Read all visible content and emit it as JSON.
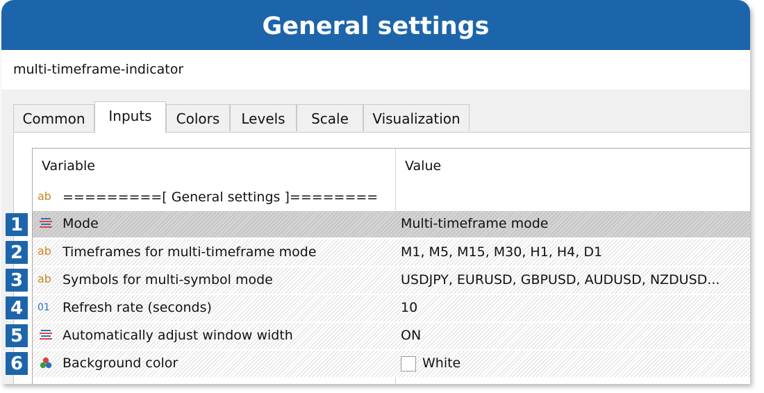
{
  "banner": {
    "title": "General settings"
  },
  "window": {
    "title": "multi-timeframe-indicator"
  },
  "tabs": [
    {
      "label": "Common",
      "active": false
    },
    {
      "label": "Inputs",
      "active": true
    },
    {
      "label": "Colors",
      "active": false
    },
    {
      "label": "Levels",
      "active": false
    },
    {
      "label": "Scale",
      "active": false
    },
    {
      "label": "Visualization",
      "active": false
    }
  ],
  "table": {
    "headers": {
      "variable": "Variable",
      "value": "Value"
    },
    "group_row": {
      "icon": "ab-string-icon",
      "label": "=========[ General settings ]========"
    },
    "rows": [
      {
        "badge": "1",
        "icon": "enum-list-icon",
        "variable": "Mode",
        "value": "Multi-timeframe mode"
      },
      {
        "badge": "2",
        "icon": "ab-string-icon",
        "variable": "Timeframes for multi-timeframe mode",
        "value": "M1, M5, M15, M30, H1, H4, D1"
      },
      {
        "badge": "3",
        "icon": "ab-string-icon",
        "variable": "Symbols for multi-symbol mode",
        "value": "USDJPY, EURUSD, GBPUSD, AUDUSD, NZDUSD..."
      },
      {
        "badge": "4",
        "icon": "integer-icon",
        "variable": "Refresh rate (seconds)",
        "value": "10"
      },
      {
        "badge": "5",
        "icon": "enum-list-icon",
        "variable": "Automatically adjust window width",
        "value": "ON"
      },
      {
        "badge": "6",
        "icon": "color-circles-icon",
        "variable": "Background color",
        "value": "White",
        "swatch_color": "#ffffff"
      }
    ]
  },
  "colors": {
    "accent": "#1d65ab",
    "string_icon": "#c9851f",
    "int_icon": "#2a6fc7",
    "enum_icon_red": "#d9453a",
    "enum_icon_blue": "#2a6fc7"
  }
}
